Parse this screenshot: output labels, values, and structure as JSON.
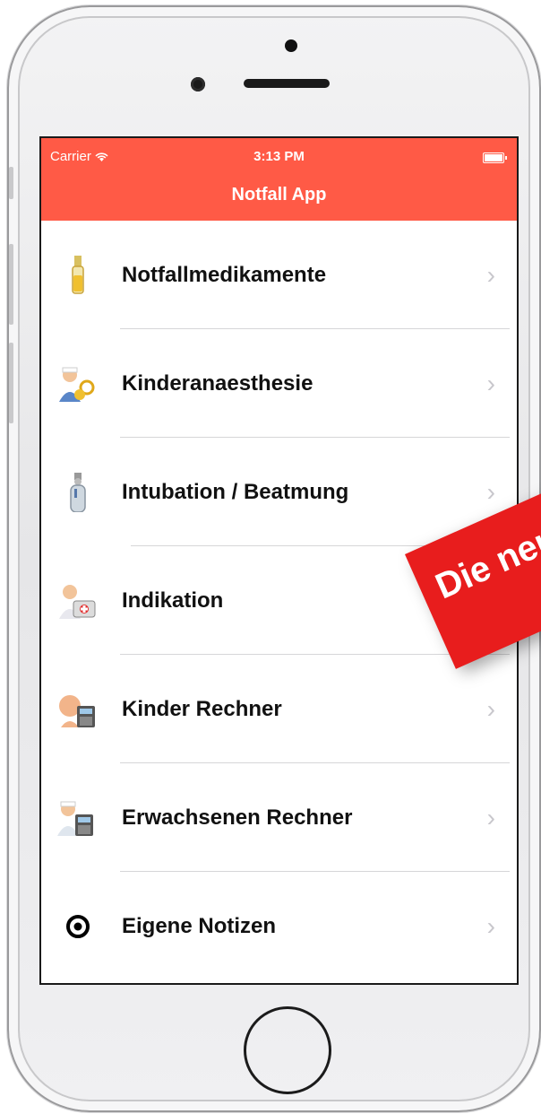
{
  "status_bar": {
    "carrier": "Carrier",
    "time": "3:13 PM"
  },
  "nav": {
    "title": "Notfall App"
  },
  "menu": [
    {
      "label": "Notfallmedikamente",
      "icon": "ampoule-icon"
    },
    {
      "label": "Kinderanaesthesie",
      "icon": "nurse-child-icon"
    },
    {
      "label": "Intubation / Beatmung",
      "icon": "oxygen-tank-icon"
    },
    {
      "label": "Indikation",
      "icon": "doctor-bag-icon"
    },
    {
      "label": "Kinder Rechner",
      "icon": "baby-calculator-icon"
    },
    {
      "label": "Erwachsenen Rechner",
      "icon": "adult-calculator-icon"
    },
    {
      "label": "Eigene Notizen",
      "icon": "target-icon"
    }
  ],
  "banner": {
    "text": "Die neu",
    "color": "#e81d1d"
  },
  "colors": {
    "nav_bg": "#ff5a46",
    "separator": "#d6d6d8"
  }
}
